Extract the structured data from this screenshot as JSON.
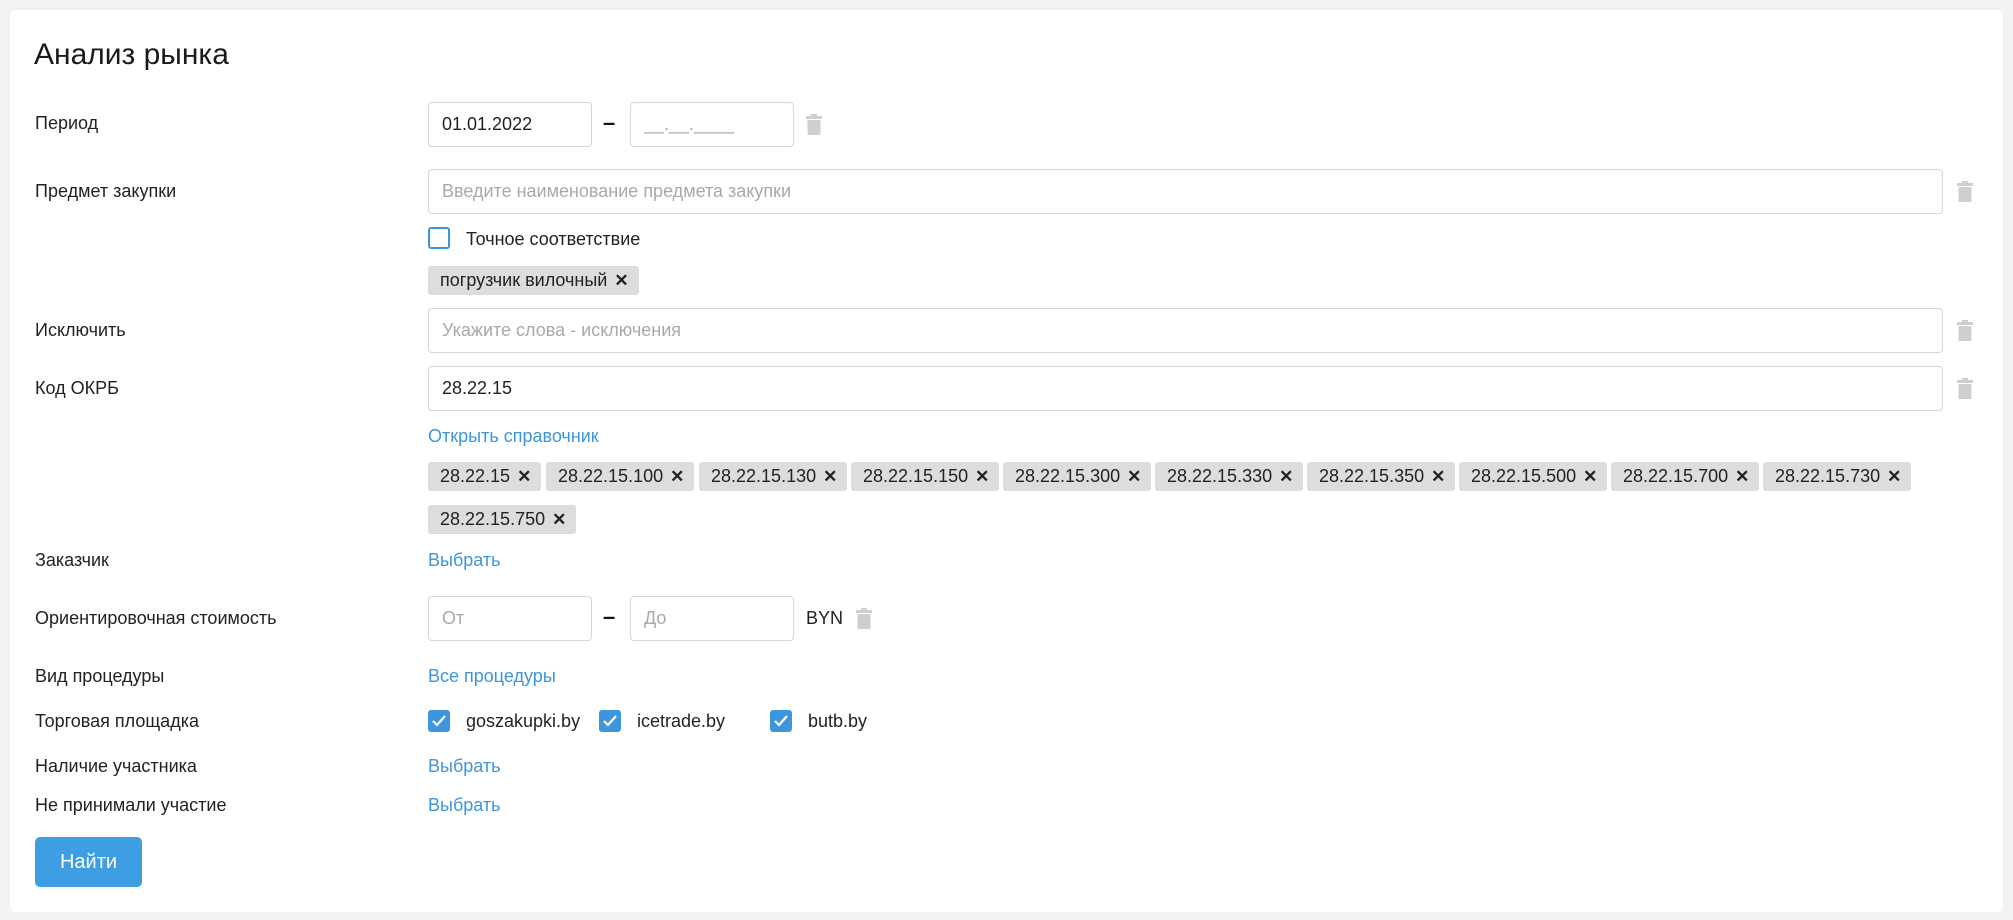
{
  "title": "Анализ рынка",
  "period": {
    "label": "Период",
    "from_value": "01.01.2022",
    "to_placeholder": "__.__.____",
    "separator": "–"
  },
  "subject": {
    "label": "Предмет закупки",
    "placeholder": "Введите наименование предмета закупки",
    "exact_match": {
      "label": "Точное соответствие",
      "checked": false
    },
    "tags": [
      "погрузчик вилочный"
    ]
  },
  "exclude": {
    "label": "Исключить",
    "placeholder": "Укажите слова - исключения"
  },
  "okrb": {
    "label": "Код ОКРБ",
    "value": "28.22.15",
    "directory_link": "Открыть справочник",
    "tags": [
      "28.22.15",
      "28.22.15.100",
      "28.22.15.130",
      "28.22.15.150",
      "28.22.15.300",
      "28.22.15.330",
      "28.22.15.350",
      "28.22.15.500",
      "28.22.15.700",
      "28.22.15.730",
      "28.22.15.750"
    ]
  },
  "customer": {
    "label": "Заказчик",
    "link": "Выбрать"
  },
  "cost": {
    "label": "Ориентировочная стоимость",
    "from_placeholder": "От",
    "to_placeholder": "До",
    "separator": "–",
    "currency": "BYN"
  },
  "procedure": {
    "label": "Вид процедуры",
    "link": "Все процедуры"
  },
  "platform": {
    "label": "Торговая площадка",
    "options": [
      {
        "label": "goszakupki.by",
        "checked": true
      },
      {
        "label": "icetrade.by",
        "checked": true
      },
      {
        "label": "butb.by",
        "checked": true
      }
    ]
  },
  "participant": {
    "label": "Наличие участника",
    "link": "Выбрать"
  },
  "not_participated": {
    "label": "Не принимали участие",
    "link": "Выбрать"
  },
  "search_button": "Найти",
  "colors": {
    "accent": "#3d96dd",
    "button": "#3d9ee4",
    "chip": "#dddddd",
    "background": "#f2f2f2"
  },
  "icons": {
    "remove": "trash-icon",
    "chip_close": "close-icon",
    "check": "check-icon"
  }
}
